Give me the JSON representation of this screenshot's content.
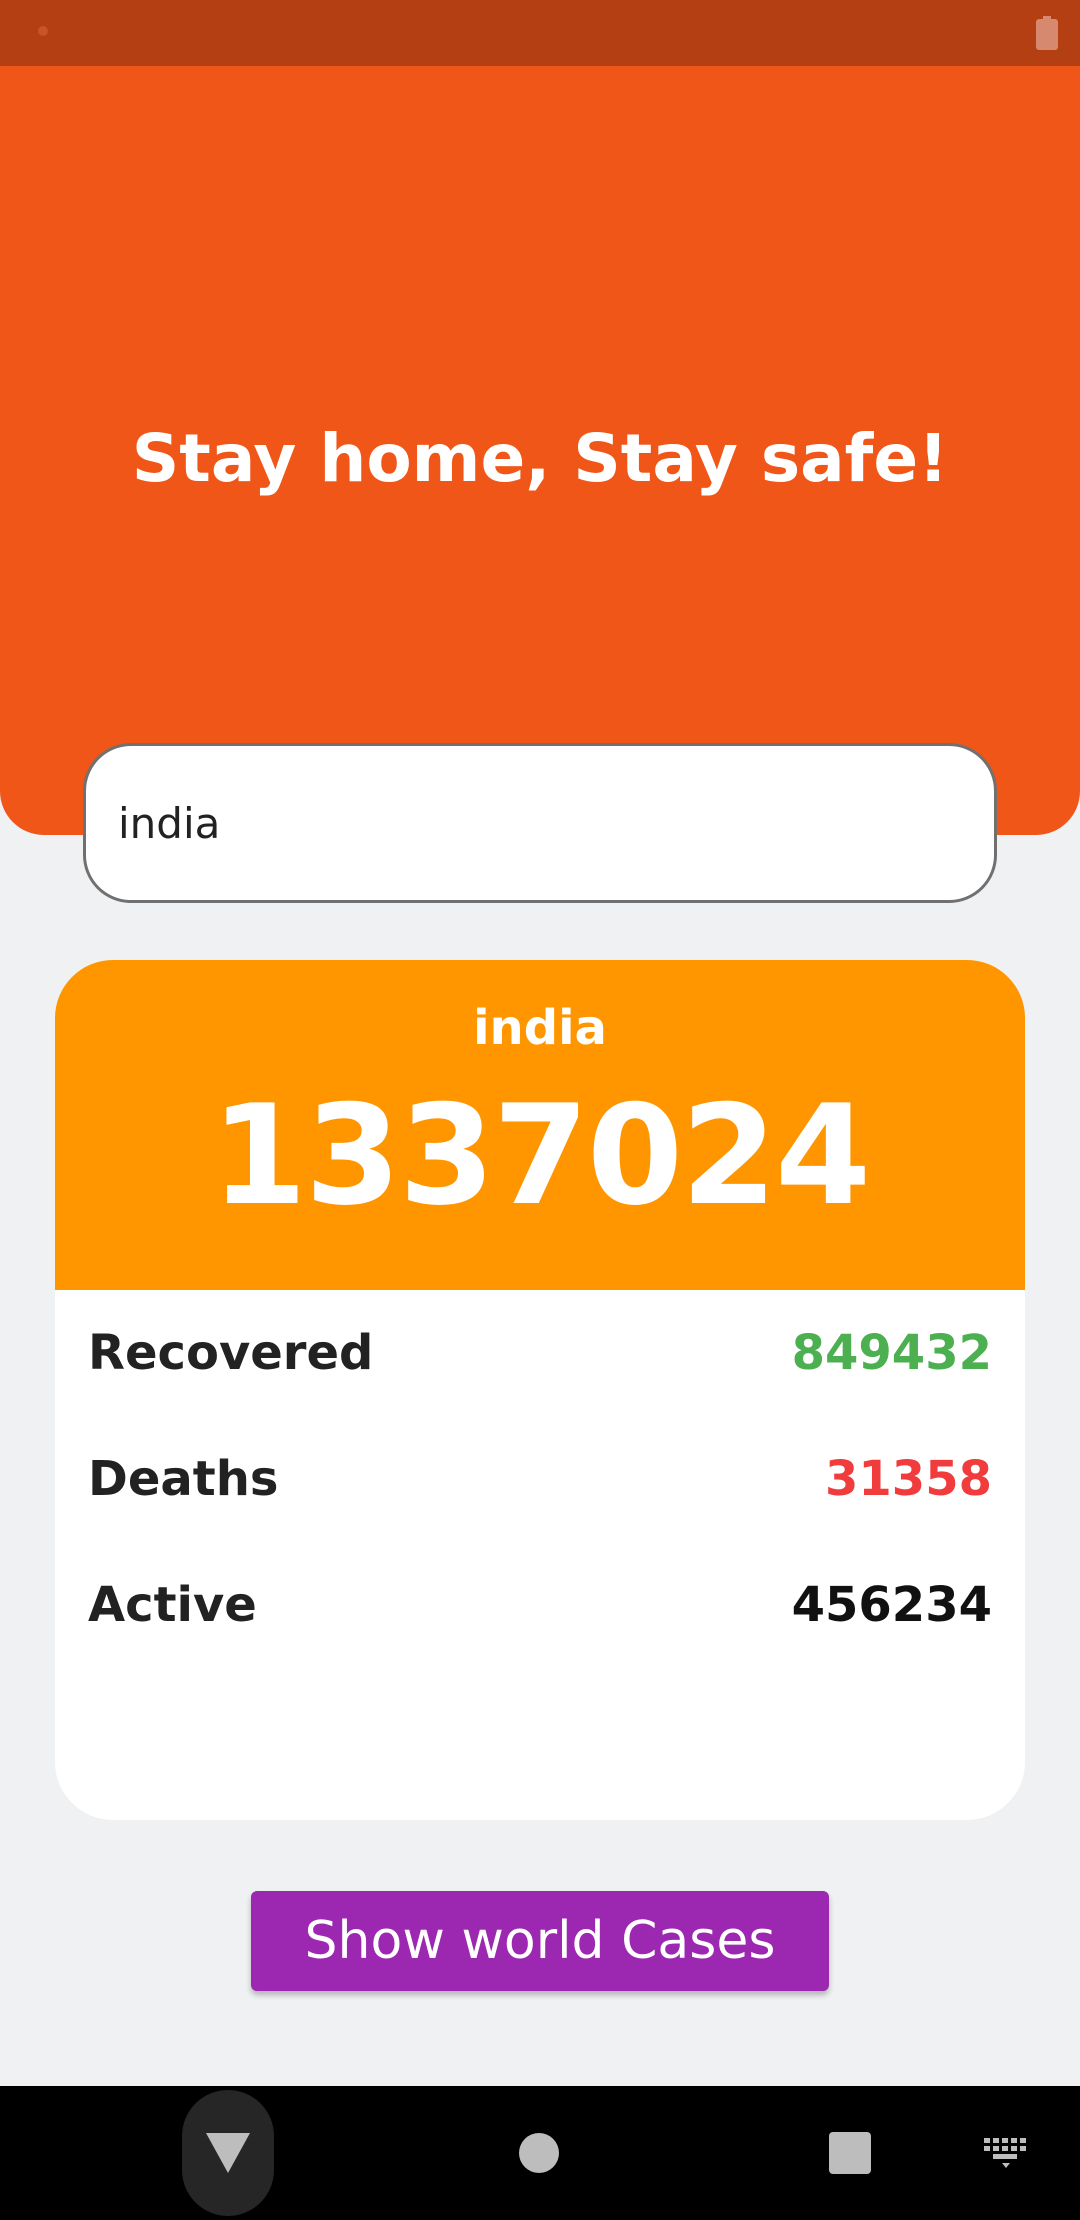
{
  "status_bar": {
    "icons": [
      "notification-dot-icon",
      "battery-icon"
    ],
    "color": "#b33f12"
  },
  "header": {
    "tagline": "Stay home, Stay safe!",
    "color": "#f05618"
  },
  "search": {
    "value": "india"
  },
  "card": {
    "country": "india",
    "total_cases": "1337024",
    "header_color": "#ff9600",
    "stats": {
      "recovered": {
        "label": "Recovered",
        "value": "849432",
        "color": "#4caf50"
      },
      "deaths": {
        "label": "Deaths",
        "value": "31358",
        "color": "#f03c3c"
      },
      "active": {
        "label": "Active",
        "value": "456234",
        "color": "#111111"
      }
    }
  },
  "world_button": {
    "label": "Show world Cases",
    "color": "#9c27b0"
  },
  "nav_bar": {
    "icons": [
      "back-icon",
      "home-icon",
      "recents-icon",
      "keyboard-icon"
    ]
  }
}
